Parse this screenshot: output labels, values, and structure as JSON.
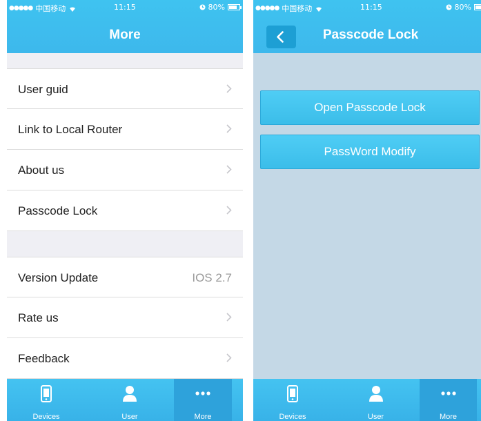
{
  "status_bar": {
    "signal": "●●●●●",
    "carrier": "中国移动",
    "time": "11:15",
    "battery_percent": "80%",
    "battery_level": 0.8
  },
  "more_screen": {
    "title": "More",
    "group1": [
      {
        "label": "User guid"
      },
      {
        "label": "Link to Local Router"
      },
      {
        "label": "About us"
      },
      {
        "label": "Passcode Lock"
      }
    ],
    "version": {
      "label": "Version Update",
      "value": "IOS 2.7"
    },
    "group2": [
      {
        "label": "Rate us"
      },
      {
        "label": "Feedback"
      }
    ]
  },
  "passcode_screen": {
    "title": "Passcode Lock",
    "open_button": "Open Passcode Lock",
    "modify_button": "PassWord Modify"
  },
  "tabbar": {
    "tabs": [
      {
        "label": "Devices",
        "icon": "phone-icon"
      },
      {
        "label": "User",
        "icon": "user-icon"
      },
      {
        "label": "More",
        "icon": "more-dots-icon"
      }
    ],
    "active": "More"
  },
  "colors": {
    "header": "#3fc3f0",
    "tabbar": "#3db8ec",
    "active_tab": "#2ea2db",
    "right_background": "#c4d8e6"
  }
}
